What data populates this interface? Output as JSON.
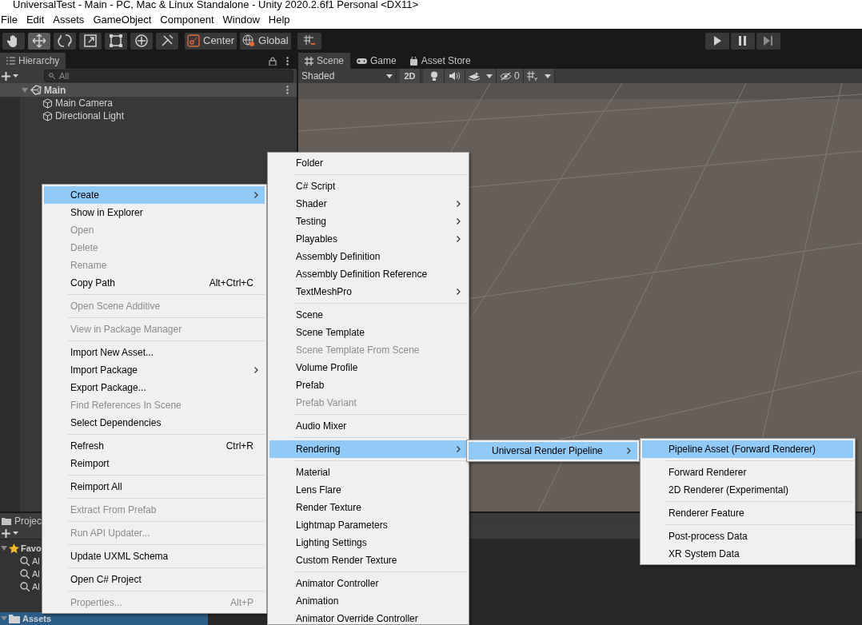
{
  "window": {
    "title": "UniversalTest - Main - PC, Mac & Linux Standalone - Unity 2020.2.6f1 Personal <DX11>"
  },
  "menu_bar": [
    "File",
    "Edit",
    "Assets",
    "GameObject",
    "Component",
    "Window",
    "Help"
  ],
  "toolbar": {
    "tools": [
      {
        "kind": "hand",
        "selected": false
      },
      {
        "kind": "move",
        "selected": true
      },
      {
        "kind": "rotate",
        "selected": false
      },
      {
        "kind": "scale",
        "selected": false
      },
      {
        "kind": "rect",
        "selected": false
      },
      {
        "kind": "transform",
        "selected": false
      },
      {
        "kind": "custom",
        "selected": false
      }
    ],
    "pivot": "Center",
    "space": "Global"
  },
  "hierarchy": {
    "title": "Hierarchy",
    "placeholder": "All",
    "scene": {
      "label": "Main",
      "expanded": true,
      "children": [
        {
          "label": "Main Camera"
        },
        {
          "label": "Directional Light"
        }
      ]
    }
  },
  "scene_view": {
    "tabs": [
      {
        "label": "Scene",
        "kind": "scene",
        "selected": true
      },
      {
        "label": "Game",
        "kind": "game",
        "selected": false
      },
      {
        "label": "Asset Store",
        "kind": "store",
        "selected": false
      }
    ],
    "shading": "Shaded",
    "mode_2d": "2D",
    "hidden_count": "0"
  },
  "project": {
    "title": "Projec",
    "tree": [
      {
        "label": "Favo",
        "kind": "favorites",
        "expanded": true,
        "selected": false,
        "children": [
          {
            "label": "Al"
          },
          {
            "label": "Al"
          },
          {
            "label": "Al"
          }
        ]
      },
      {
        "label": "Assets",
        "kind": "folder",
        "expanded": true,
        "selected": true
      }
    ]
  },
  "context_menus": [
    {
      "items": [
        {
          "kind": "item",
          "label": "Create",
          "submenu": true,
          "disabled": false,
          "selected": true
        },
        {
          "kind": "item",
          "label": "Show in Explorer",
          "submenu": false,
          "disabled": false,
          "selected": false
        },
        {
          "kind": "item",
          "label": "Open",
          "submenu": false,
          "disabled": true,
          "selected": false
        },
        {
          "kind": "item",
          "label": "Delete",
          "submenu": false,
          "disabled": true,
          "selected": false
        },
        {
          "kind": "item",
          "label": "Rename",
          "submenu": false,
          "disabled": true,
          "selected": false
        },
        {
          "kind": "item",
          "label": "Copy Path",
          "shortcut": "Alt+Ctrl+C",
          "submenu": false,
          "disabled": false,
          "selected": false
        },
        {
          "kind": "separator"
        },
        {
          "kind": "item",
          "label": "Open Scene Additive",
          "submenu": false,
          "disabled": true,
          "selected": false
        },
        {
          "kind": "separator"
        },
        {
          "kind": "item",
          "label": "View in Package Manager",
          "submenu": false,
          "disabled": true,
          "selected": false
        },
        {
          "kind": "separator"
        },
        {
          "kind": "item",
          "label": "Import New Asset...",
          "submenu": false,
          "disabled": false,
          "selected": false
        },
        {
          "kind": "item",
          "label": "Import Package",
          "submenu": true,
          "disabled": false,
          "selected": false
        },
        {
          "kind": "item",
          "label": "Export Package...",
          "submenu": false,
          "disabled": false,
          "selected": false
        },
        {
          "kind": "item",
          "label": "Find References In Scene",
          "submenu": false,
          "disabled": true,
          "selected": false
        },
        {
          "kind": "item",
          "label": "Select Dependencies",
          "submenu": false,
          "disabled": false,
          "selected": false
        },
        {
          "kind": "separator"
        },
        {
          "kind": "item",
          "label": "Refresh",
          "shortcut": "Ctrl+R",
          "submenu": false,
          "disabled": false,
          "selected": false
        },
        {
          "kind": "item",
          "label": "Reimport",
          "submenu": false,
          "disabled": false,
          "selected": false
        },
        {
          "kind": "separator"
        },
        {
          "kind": "item",
          "label": "Reimport All",
          "submenu": false,
          "disabled": false,
          "selected": false
        },
        {
          "kind": "separator"
        },
        {
          "kind": "item",
          "label": "Extract From Prefab",
          "submenu": false,
          "disabled": true,
          "selected": false
        },
        {
          "kind": "separator"
        },
        {
          "kind": "item",
          "label": "Run API Updater...",
          "submenu": false,
          "disabled": true,
          "selected": false
        },
        {
          "kind": "separator"
        },
        {
          "kind": "item",
          "label": "Update UXML Schema",
          "submenu": false,
          "disabled": false,
          "selected": false
        },
        {
          "kind": "separator"
        },
        {
          "kind": "item",
          "label": "Open C# Project",
          "submenu": false,
          "disabled": false,
          "selected": false
        },
        {
          "kind": "separator"
        },
        {
          "kind": "item",
          "label": "Properties...",
          "shortcut": "Alt+P",
          "submenu": false,
          "disabled": true,
          "selected": false
        }
      ]
    },
    {
      "items": [
        {
          "kind": "item",
          "label": "Folder",
          "submenu": false,
          "disabled": false,
          "selected": false
        },
        {
          "kind": "separator"
        },
        {
          "kind": "item",
          "label": "C# Script",
          "submenu": false,
          "disabled": false,
          "selected": false
        },
        {
          "kind": "item",
          "label": "Shader",
          "submenu": true,
          "disabled": false,
          "selected": false
        },
        {
          "kind": "item",
          "label": "Testing",
          "submenu": true,
          "disabled": false,
          "selected": false
        },
        {
          "kind": "item",
          "label": "Playables",
          "submenu": true,
          "disabled": false,
          "selected": false
        },
        {
          "kind": "item",
          "label": "Assembly Definition",
          "submenu": false,
          "disabled": false,
          "selected": false
        },
        {
          "kind": "item",
          "label": "Assembly Definition Reference",
          "submenu": false,
          "disabled": false,
          "selected": false
        },
        {
          "kind": "item",
          "label": "TextMeshPro",
          "submenu": true,
          "disabled": false,
          "selected": false
        },
        {
          "kind": "separator"
        },
        {
          "kind": "item",
          "label": "Scene",
          "submenu": false,
          "disabled": false,
          "selected": false
        },
        {
          "kind": "item",
          "label": "Scene Template",
          "submenu": false,
          "disabled": false,
          "selected": false
        },
        {
          "kind": "item",
          "label": "Scene Template From Scene",
          "submenu": false,
          "disabled": true,
          "selected": false
        },
        {
          "kind": "item",
          "label": "Volume Profile",
          "submenu": false,
          "disabled": false,
          "selected": false
        },
        {
          "kind": "item",
          "label": "Prefab",
          "submenu": false,
          "disabled": false,
          "selected": false
        },
        {
          "kind": "item",
          "label": "Prefab Variant",
          "submenu": false,
          "disabled": true,
          "selected": false
        },
        {
          "kind": "separator"
        },
        {
          "kind": "item",
          "label": "Audio Mixer",
          "submenu": false,
          "disabled": false,
          "selected": false
        },
        {
          "kind": "separator"
        },
        {
          "kind": "item",
          "label": "Rendering",
          "submenu": true,
          "disabled": false,
          "selected": true
        },
        {
          "kind": "separator"
        },
        {
          "kind": "item",
          "label": "Material",
          "submenu": false,
          "disabled": false,
          "selected": false
        },
        {
          "kind": "item",
          "label": "Lens Flare",
          "submenu": false,
          "disabled": false,
          "selected": false
        },
        {
          "kind": "item",
          "label": "Render Texture",
          "submenu": false,
          "disabled": false,
          "selected": false
        },
        {
          "kind": "item",
          "label": "Lightmap Parameters",
          "submenu": false,
          "disabled": false,
          "selected": false
        },
        {
          "kind": "item",
          "label": "Lighting Settings",
          "submenu": false,
          "disabled": false,
          "selected": false
        },
        {
          "kind": "item",
          "label": "Custom Render Texture",
          "submenu": false,
          "disabled": false,
          "selected": false
        },
        {
          "kind": "separator"
        },
        {
          "kind": "item",
          "label": "Animator Controller",
          "submenu": false,
          "disabled": false,
          "selected": false
        },
        {
          "kind": "item",
          "label": "Animation",
          "submenu": false,
          "disabled": false,
          "selected": false
        },
        {
          "kind": "item",
          "label": "Animator Override Controller",
          "submenu": false,
          "disabled": false,
          "selected": false
        }
      ]
    },
    {
      "items": [
        {
          "kind": "item",
          "label": "Universal Render Pipeline",
          "submenu": true,
          "disabled": false,
          "selected": true
        }
      ]
    },
    {
      "items": [
        {
          "kind": "item",
          "label": "Pipeline Asset (Forward Renderer)",
          "submenu": false,
          "disabled": false,
          "selected": true
        },
        {
          "kind": "separator"
        },
        {
          "kind": "item",
          "label": "Forward Renderer",
          "submenu": false,
          "disabled": false,
          "selected": false
        },
        {
          "kind": "item",
          "label": "2D Renderer (Experimental)",
          "submenu": false,
          "disabled": false,
          "selected": false
        },
        {
          "kind": "separator"
        },
        {
          "kind": "item",
          "label": "Renderer Feature",
          "submenu": false,
          "disabled": false,
          "selected": false
        },
        {
          "kind": "separator"
        },
        {
          "kind": "item",
          "label": "Post-process Data",
          "submenu": false,
          "disabled": false,
          "selected": false
        },
        {
          "kind": "item",
          "label": "XR System Data",
          "submenu": false,
          "disabled": false,
          "selected": false
        }
      ]
    }
  ]
}
